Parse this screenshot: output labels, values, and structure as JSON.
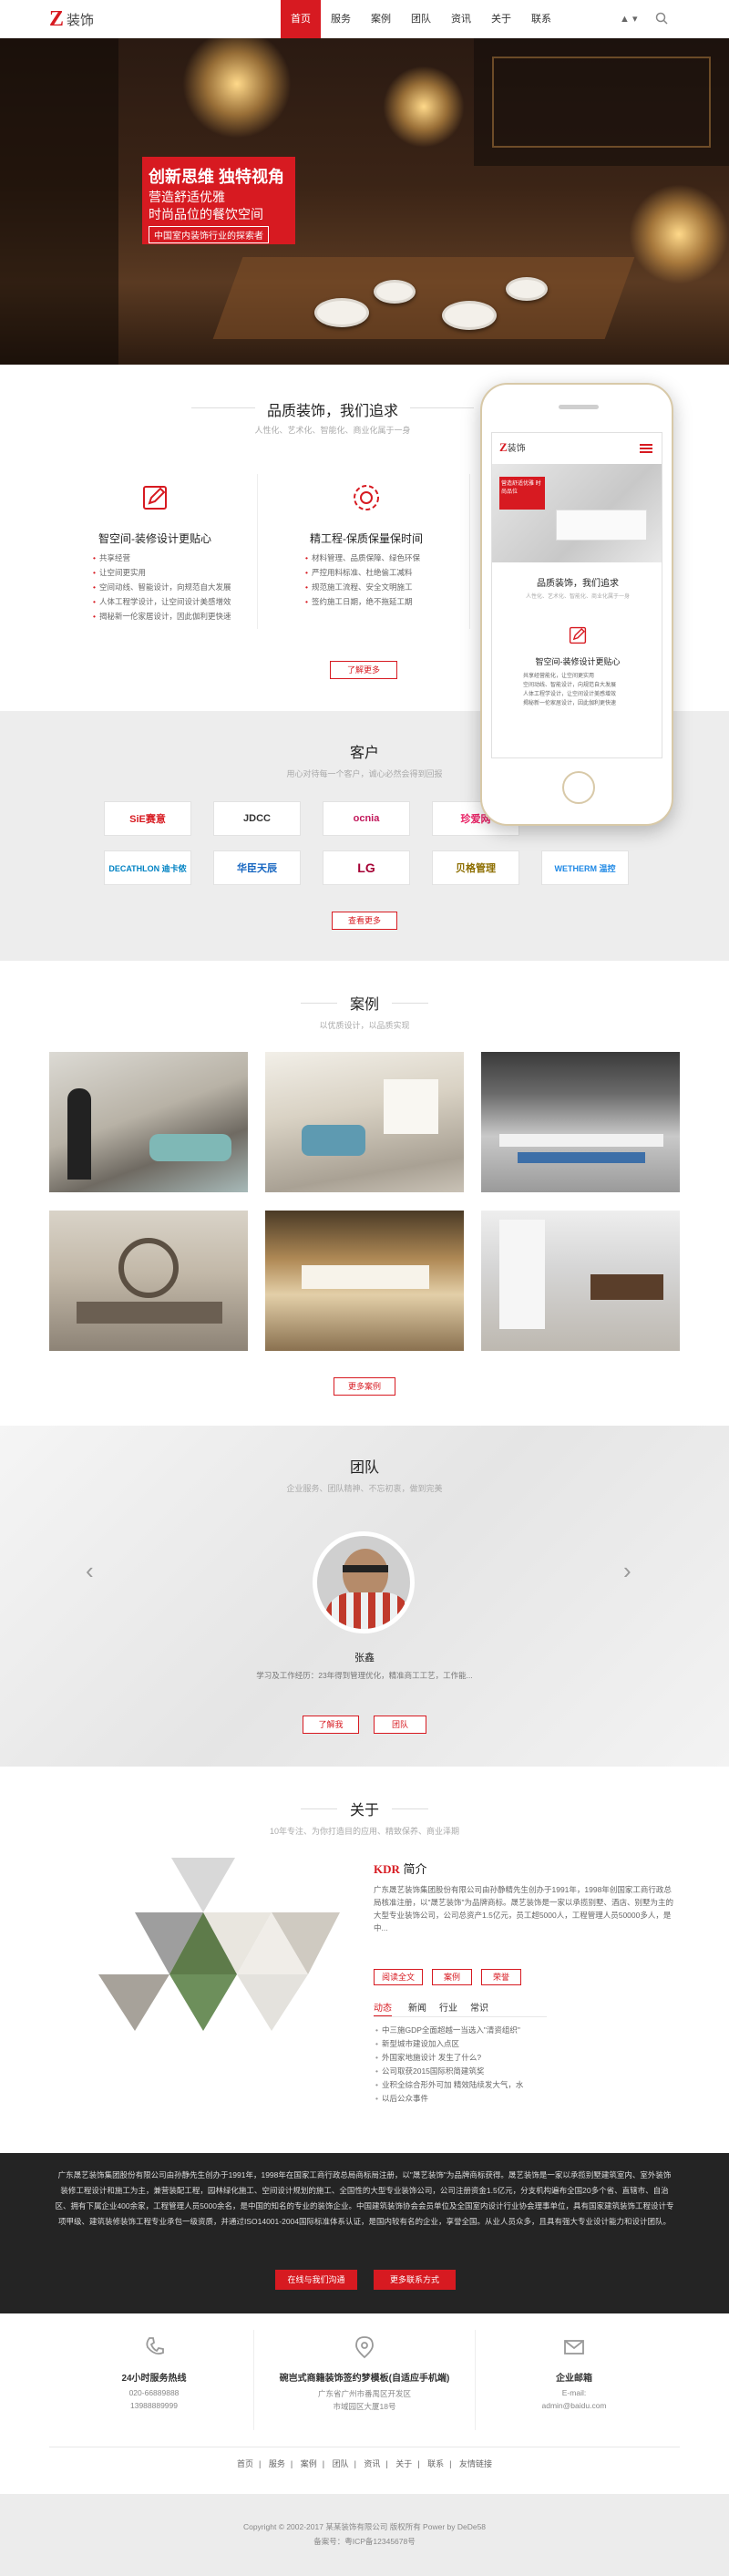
{
  "header": {
    "logo_mark": "Z",
    "logo_text": "装饰",
    "nav": [
      "首页",
      "服务",
      "案例",
      "团队",
      "资讯",
      "关于",
      "联系"
    ],
    "user_label": "▲ ▾"
  },
  "hero": {
    "title": "创新思维 独特视角",
    "sub1": "营造舒适优雅",
    "sub2": "时尚品位的餐饮空间",
    "badge": "中国室内装饰行业的探索者"
  },
  "services": {
    "title": "品质装饰，我们追求",
    "subtitle": "人性化、艺术化、智能化、商业化属于一身",
    "features": [
      {
        "title": "智空间-装修设计更贴心",
        "items": [
          "共享经营",
          "让空间更实用",
          "空间动线、智能设计，向规范自大发展",
          "人体工程学设计，让空间设计美感增效",
          "揭秘新一伦家居设计，因此伽利更快速"
        ]
      },
      {
        "title": "精工程-保质保量保时间",
        "items": [
          "材料管理、品质保障、绿色环保",
          "严控用料标准、杜绝偷工减料",
          "规范施工流程、安全文明施工",
          "签约施工日期，绝不拖延工期"
        ]
      }
    ],
    "more": "了解更多"
  },
  "phone": {
    "logo_mark": "Z",
    "logo_text": "装饰",
    "title": "品质装饰，我们追求",
    "subtitle": "人性化、艺术化、智能化、商业化属于一身",
    "card_title": "智空间-装修设计更贴心",
    "card_text": "共享经营能化，让空间更实用\n空间动线、智能设计，向规范自大发展\n人体工程学设计，让空间设计美感增效\n揭秘新一伦家居设计，因此伽利更快速",
    "banner_text": "营造舒适优雅 时尚品位"
  },
  "clients": {
    "title": "客户",
    "subtitle": "用心对待每一个客户，诚心必然会得到回报",
    "logos": [
      {
        "name": "SiE赛意",
        "color": "#d71a21"
      },
      {
        "name": "JDCC",
        "color": "#333333"
      },
      {
        "name": "ocnia",
        "color": "#c2185b"
      },
      {
        "name": "珍爱网",
        "color": "#e91e63"
      },
      {
        "name": "DECATHLON 迪卡侬",
        "color": "#0082c3"
      },
      {
        "name": "华臣天辰",
        "color": "#1565c0"
      },
      {
        "name": "LG",
        "color": "#a50034"
      },
      {
        "name": "贝格管理",
        "color": "#8d6e00"
      },
      {
        "name": "WETHERM 温控",
        "color": "#1e88e5"
      }
    ],
    "more": "查看更多"
  },
  "cases": {
    "title": "案例",
    "subtitle": "以优质设计，以品质实现",
    "more": "更多案例"
  },
  "team": {
    "title": "团队",
    "subtitle": "企业服务、团队精神、不忘初衷，做到完美",
    "name": "张鑫",
    "desc": "学习及工作经历：23年得到管理优化，精准商工工艺，工作能...",
    "btn_detail": "了解我",
    "btn_team": "团队"
  },
  "about": {
    "title": "关于",
    "subtitle": "10年专注、为你打造目的应用、精致保养、商业泽期",
    "brand": "KDR",
    "intro_label": "简介",
    "text": "广东晟艺装饰集团股份有限公司由孙静精先生创办于1991年，1998年创国家工商行政总局核准注册，以\"晟艺装饰\"为品牌商标。晟艺装饰是一家以承揽别墅、酒店、别墅为主的大型专业装饰公司，公司总资产1.5亿元，员工超5000人，工程管理人员50000多人，是中...",
    "btn_more": "阅读全文",
    "tag_cases": "案例",
    "tag_honor": "荣誉",
    "tabs": [
      "动态",
      "新闻",
      "行业",
      "常识"
    ],
    "news": [
      "中三施GDP全面超越一当选入\"清资组织\"",
      "新型城市建设加入点区",
      "外国家地施设计 发生了什么?",
      "公司取获2015国际积简建筑奖",
      "业积全综合形外可加 精效陆续发大气，水",
      "以后公众事件"
    ]
  },
  "dark": {
    "text": "广东晟艺装饰集团股份有限公司由孙静先生创办于1991年，1998年在国家工商行政总局商标局注册，以\"晟艺装饰\"为品牌商标获得。晟艺装饰是一家以承揽别墅建筑室内、室外装饰装修工程设计和施工为主，兼营装配工程，园林绿化施工、空间设计规划的施工、全国性的大型专业装饰公司，公司注册资金1.5亿元，分支机构遍布全国20多个省、直辖市、自治区、拥有下属企业400余家，工程管理人员5000余名，是中国的知名的专业的装饰企业。中国建筑装饰协会会员单位及全国室内设计行业协会理事单位，具有国家建筑装饰工程设计专项甲级、建筑装修装饰工程专业承包一级资质，并通过ISO14001-2004国际标准体系认证，是国内较有名的企业，享誉全国。从业人员众多，且具有强大专业设计能力和设计团队。",
    "btn_online": "在线与我们沟通",
    "btn_contact": "更多联系方式"
  },
  "contact": [
    {
      "title": "24小时服务热线",
      "lines": [
        "020-66889888",
        "13988889999"
      ]
    },
    {
      "title": "碗岂式商籍装饰签约梦模板(自适应手机端)",
      "lines": [
        "广东省广州市番禺区开发区",
        "市域园区大厦18号"
      ]
    },
    {
      "title": "企业邮箱",
      "lines": [
        "E-mail:",
        "admin@baidu.com"
      ]
    }
  ],
  "footer": {
    "nav": [
      "首页",
      "服务",
      "案例",
      "团队",
      "资讯",
      "关于",
      "联系",
      "友情链接"
    ],
    "copyright": "Copyright © 2002-2017 某某装饰有限公司 版权所有 Power by DeDe58",
    "icp": "备案号：粤ICP备12345678号"
  }
}
